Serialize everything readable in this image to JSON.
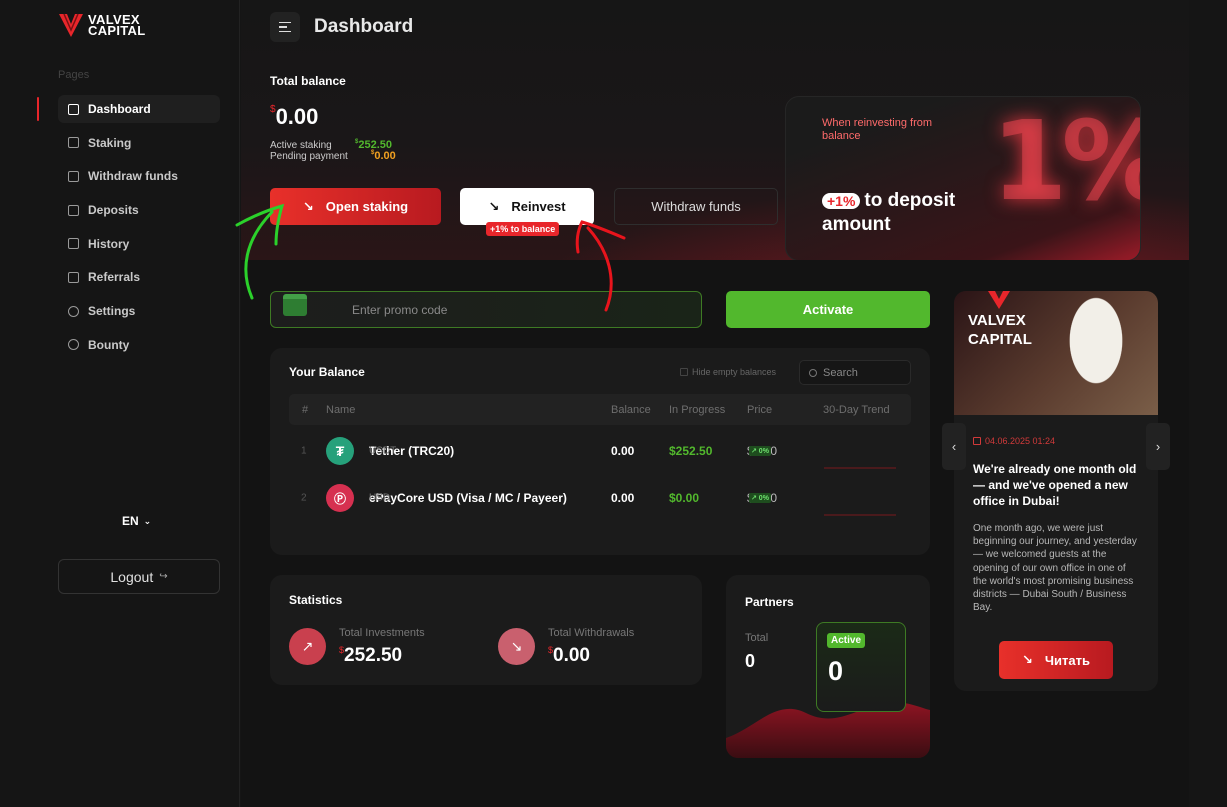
{
  "brand": {
    "name_line1": "VALVEX",
    "name_line2": "CAPITAL"
  },
  "sidebar": {
    "section_label": "Pages",
    "items": [
      {
        "label": "Dashboard",
        "icon": "grid-icon",
        "active": true
      },
      {
        "label": "Staking",
        "icon": "wallet-icon",
        "active": false
      },
      {
        "label": "Withdraw funds",
        "icon": "vault-icon",
        "active": false
      },
      {
        "label": "Deposits",
        "icon": "chart-icon",
        "active": false
      },
      {
        "label": "History",
        "icon": "document-icon",
        "active": false
      },
      {
        "label": "Referrals",
        "icon": "megaphone-icon",
        "active": false
      },
      {
        "label": "Settings",
        "icon": "gear-icon",
        "active": false
      },
      {
        "label": "Bounty",
        "icon": "target-icon",
        "active": false
      }
    ],
    "language": "EN",
    "logout_label": "Logout"
  },
  "header": {
    "title": "Dashboard"
  },
  "balance": {
    "label": "Total balance",
    "currency_symbol": "$",
    "value": "0.00",
    "active_staking_label": "Active staking",
    "active_staking_value": "252.50",
    "pending_payment_label": "Pending payment",
    "pending_payment_value": "0.00"
  },
  "actions": {
    "open_staking": "Open staking",
    "reinvest": "Reinvest",
    "reinvest_badge": "+1% to balance",
    "withdraw": "Withdraw funds"
  },
  "promo_banner": {
    "small_text": "When reinvesting from balance",
    "pill": "+1%",
    "big_text_1": "to deposit",
    "big_text_2": "amount",
    "big_number": "1%"
  },
  "promo_code": {
    "placeholder": "Enter promo code",
    "activate_label": "Activate"
  },
  "your_balance": {
    "title": "Your Balance",
    "hide_empty_label": "Hide empty balances",
    "search_placeholder": "Search",
    "columns": [
      "#",
      "Name",
      "Balance",
      "In Progress",
      "Price",
      "30-Day Trend"
    ],
    "rows": [
      {
        "index": "1",
        "name": "Tether (TRC20)",
        "ticker": "USDT",
        "balance": "0.00",
        "in_progress": "$252.50",
        "price": "$1.00",
        "change": "↗ 0%",
        "icon": "tether-icon",
        "color": "#26a17b"
      },
      {
        "index": "2",
        "name": "ePayCore USD (Visa / MC / Payeer)",
        "ticker": "USD",
        "balance": "0.00",
        "in_progress": "$0.00",
        "price": "$1.00",
        "change": "↗ 0%",
        "icon": "epaycore-icon",
        "color": "#d63050"
      }
    ]
  },
  "statistics": {
    "title": "Statistics",
    "investments_label": "Total Investments",
    "investments_value": "252.50",
    "withdrawals_label": "Total Withdrawals",
    "withdrawals_value": "0.00",
    "currency_symbol": "$"
  },
  "partners": {
    "title": "Partners",
    "total_label": "Total",
    "total_value": "0",
    "active_label": "Active",
    "active_value": "0"
  },
  "news": {
    "logo_line1": "VALVEX",
    "logo_line2": "CAPITAL",
    "date": "04.06.2025 01:24",
    "title": "We're already one month old — and we've opened a new office in Dubai!",
    "body": "One month ago, we were just beginning our journey, and yesterday — we welcomed guests at the opening of our own office in one of the world's most promising business districts — Dubai South / Business Bay.",
    "read_label": "Читать"
  },
  "colors": {
    "accent_red": "#e8262b",
    "accent_green": "#52b82d",
    "background": "#131313",
    "card": "#1b1b1b"
  }
}
